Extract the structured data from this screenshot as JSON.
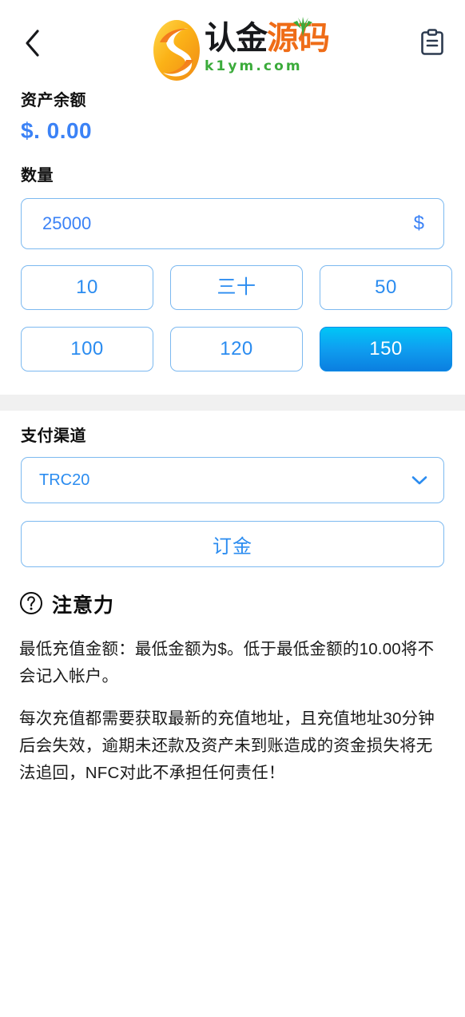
{
  "header": {
    "back_icon": "chevron-left-icon",
    "orders_icon": "clipboard-icon",
    "logo": {
      "text_part1": "认",
      "text_part2": "金",
      "text_part3": "源码",
      "domain": "k1ym.com"
    }
  },
  "balance": {
    "label": "资产余额",
    "value": "$. 0.00",
    "value_color": "#3b82f6"
  },
  "amount": {
    "label": "数量",
    "input_value": "25000",
    "input_placeholder": "",
    "currency_suffix": "$",
    "presets": [
      {
        "label": "10",
        "selected": false
      },
      {
        "label": "三十",
        "selected": false
      },
      {
        "label": "50",
        "selected": false
      },
      {
        "label": "100",
        "selected": false
      },
      {
        "label": "120",
        "selected": false
      },
      {
        "label": "150",
        "selected": true
      }
    ],
    "selected_gradient_from": "#00c6f7",
    "selected_gradient_to": "#0b7fe0"
  },
  "channel": {
    "label": "支付渠道",
    "selected": "TRC20",
    "options": [
      "TRC20"
    ],
    "chevron_icon": "chevron-down-icon",
    "submit_label": "订金"
  },
  "notice": {
    "icon": "question-circle-icon",
    "title": "注意力",
    "paragraph1": "最低充值金额：最低金额为$。低于最低金额的10.00将不会记入帐户。",
    "paragraph2": "每次充值都需要获取最新的充值地址，且充值地址30分钟后会失效，逾期未还款及资产未到账造成的资金损失将无法追回，NFC对此不承担任何责任！"
  },
  "theme": {
    "accent": "#2b8cf0",
    "border": "#7cb9f0",
    "band": "#f0f0f0",
    "icon_dark": "#2c3a4f"
  }
}
